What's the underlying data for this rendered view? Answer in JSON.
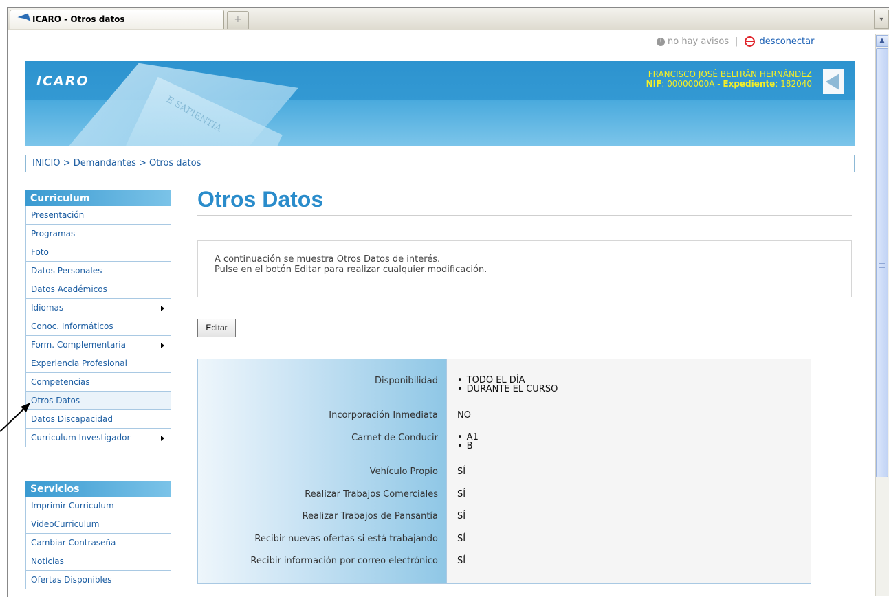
{
  "browser": {
    "tab_title": "ICARO - Otros datos",
    "new_tab_symbol": "+"
  },
  "toplinks": {
    "notices": "no hay avisos",
    "separator": "|",
    "disconnect": "desconectar"
  },
  "header": {
    "logo": "ICARO",
    "watermark": "E SAPIENTIA",
    "user_name": "FRANCISCO JOSÉ BELTRÁN HERNÁNDEZ",
    "nif_label": "NIF",
    "nif_value": ": 00000000A - ",
    "expediente_label": "Expediente",
    "expediente_value": ": 182040"
  },
  "breadcrumb": "INICIO > Demandantes > Otros datos",
  "sidebar": {
    "curriculum": {
      "title": "Curriculum",
      "items": [
        {
          "label": "Presentación",
          "arrow": false
        },
        {
          "label": "Programas",
          "arrow": false
        },
        {
          "label": "Foto",
          "arrow": false
        },
        {
          "label": "Datos Personales",
          "arrow": false
        },
        {
          "label": "Datos Académicos",
          "arrow": false
        },
        {
          "label": "Idiomas",
          "arrow": true
        },
        {
          "label": "Conoc. Informáticos",
          "arrow": false
        },
        {
          "label": "Form. Complementaria",
          "arrow": true
        },
        {
          "label": "Experiencia Profesional",
          "arrow": false
        },
        {
          "label": "Competencias",
          "arrow": false
        },
        {
          "label": "Otros Datos",
          "arrow": false
        },
        {
          "label": "Datos Discapacidad",
          "arrow": false
        },
        {
          "label": "Curriculum Investigador",
          "arrow": true
        }
      ]
    },
    "servicios": {
      "title": "Servicios",
      "items": [
        {
          "label": "Imprimir Curriculum"
        },
        {
          "label": "VideoCurriculum"
        },
        {
          "label": "Cambiar Contraseña"
        },
        {
          "label": "Noticias"
        },
        {
          "label": "Ofertas Disponibles"
        }
      ]
    }
  },
  "main": {
    "title": "Otros Datos",
    "intro_line1": "A continuación se muestra Otros Datos de interés.",
    "intro_line2": "Pulse en el botón Editar para realizar cualquier modificación.",
    "edit_label": "Editar",
    "rows": [
      {
        "label": "Disponibilidad",
        "values": [
          "TODO EL DÍA",
          "DURANTE EL CURSO"
        ]
      },
      {
        "label": "Incorporación Inmediata",
        "value": "NO"
      },
      {
        "label": "Carnet de Conducir",
        "values": [
          "A1",
          "B"
        ]
      },
      {
        "label": "Vehículo Propio",
        "value": "SÍ"
      },
      {
        "label": "Realizar Trabajos Comerciales",
        "value": "SÍ"
      },
      {
        "label": "Realizar Trabajos de Pansantía",
        "value": "SÍ"
      },
      {
        "label": "Recibir nuevas ofertas si está trabajando",
        "value": "SÍ"
      },
      {
        "label": "Recibir información por correo electrónico",
        "value": "SÍ"
      }
    ]
  }
}
